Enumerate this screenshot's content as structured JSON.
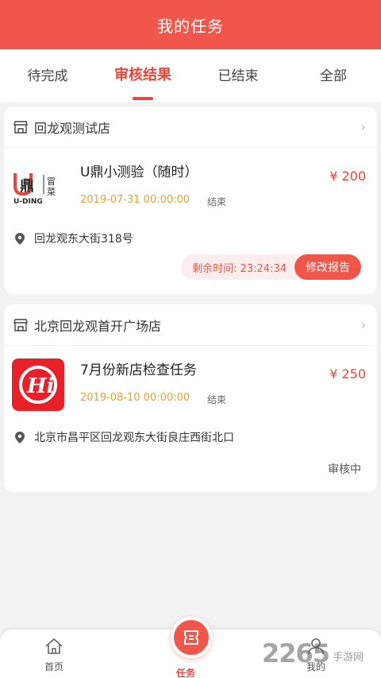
{
  "header": {
    "title": "我的任务"
  },
  "tabs": [
    {
      "label": "待完成",
      "active": false
    },
    {
      "label": "审核结果",
      "active": true
    },
    {
      "label": "已结束",
      "active": false
    },
    {
      "label": "全部",
      "active": false
    }
  ],
  "tasks": [
    {
      "store": "回龙观测试店",
      "logo": {
        "brand": "U-DING",
        "text_main": "U鼎",
        "text_side": "冒菜",
        "caption": "U-DING"
      },
      "title": "U鼎小测验（随时）",
      "date": "2019-07-31 00:00:00",
      "status": "结束",
      "price": "¥ 200",
      "address": "回龙观东大街318号",
      "remaining_time": "剩余时间: 23:24:34",
      "action": "修改报告"
    },
    {
      "store": "北京回龙观首开广场店",
      "logo": {
        "brand": "Hi",
        "text_main": "Hi"
      },
      "title": "7月份新店检查任务",
      "date": "2019-08-10 00:00:00",
      "status": "结束",
      "price": "¥ 250",
      "address": "北京市昌平区回龙观东大街良庄西街北口",
      "review_status": "审核中"
    }
  ],
  "bottom_nav": [
    {
      "label": "首页",
      "icon": "home-icon"
    },
    {
      "label": "任务",
      "icon": "task-icon",
      "active": true
    },
    {
      "label": "我的",
      "icon": "user-icon"
    }
  ],
  "watermark": {
    "number": "2265",
    "text": "手游网"
  },
  "colors": {
    "primary": "#f0574a",
    "accent": "#e8473d",
    "date": "#e2a23c"
  }
}
